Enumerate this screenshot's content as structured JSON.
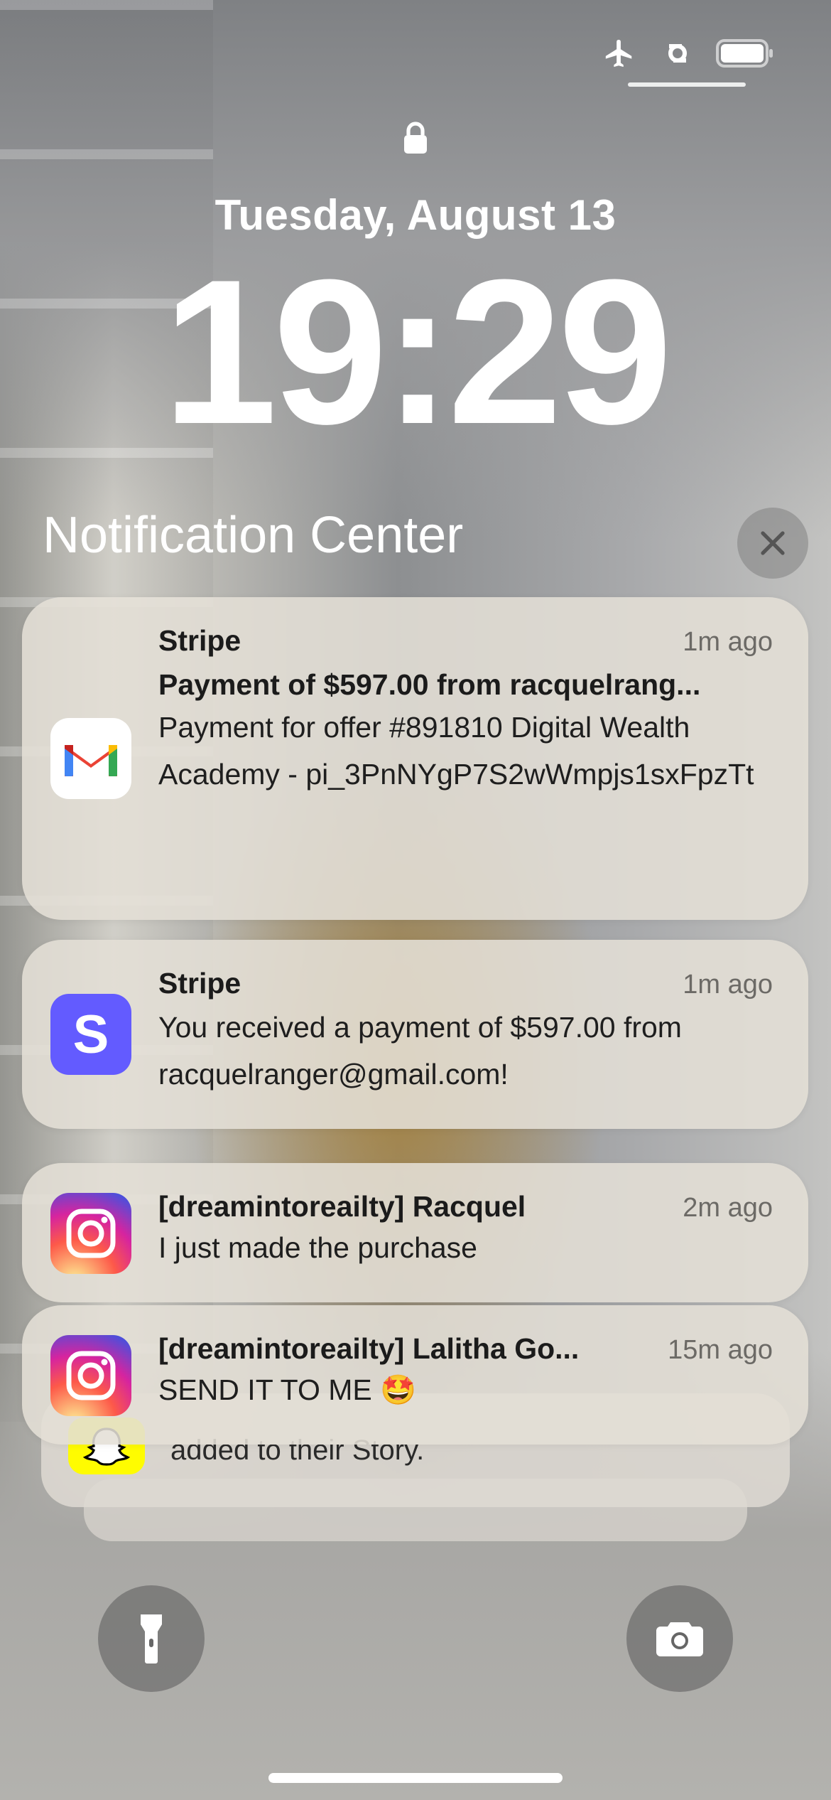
{
  "lock_screen": {
    "date": "Tuesday, August 13",
    "time": "19:29"
  },
  "status_bar": {
    "icons": [
      "airplane-mode-icon",
      "link-icon",
      "battery-icon"
    ]
  },
  "notification_center": {
    "title": "Notification Center"
  },
  "notifications": [
    {
      "app_icon": "gmail-icon",
      "title": "Stripe",
      "time": "1m ago",
      "subject": "Payment of $597.00 from racquelrang...",
      "body": "Payment for offer #891810 Digital Wealth Academy - pi_3PnNYgP7S2wWmpjs1sxFpzTt"
    },
    {
      "app_icon": "stripe-icon",
      "title": "Stripe",
      "time": "1m ago",
      "body": "You received a payment of $597.00 from racquelranger@gmail.com!"
    },
    {
      "app_icon": "instagram-icon",
      "title": "[dreamintoreailty] Racquel",
      "time": "2m ago",
      "body": "I just made the purchase"
    },
    {
      "app_icon": "instagram-icon",
      "title": "[dreamintoreailty] Lalitha Go...",
      "time": "15m ago",
      "body": "SEND IT TO ME 🤩"
    },
    {
      "app_icon": "snapchat-icon",
      "body": "added to their Story."
    }
  ],
  "bottom_controls": {
    "left": "flashlight-icon",
    "right": "camera-icon"
  },
  "colors": {
    "stripe": "#635BFF",
    "card_bg": "#E4DFD6"
  }
}
